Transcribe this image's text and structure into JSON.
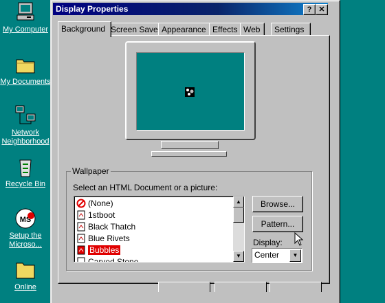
{
  "desktop": {
    "icons": [
      {
        "label": "My Computer"
      },
      {
        "label": "My Documents"
      },
      {
        "label": "Network Neighborhood"
      },
      {
        "label": "Recycle Bin"
      },
      {
        "label": "Setup the Microso..."
      },
      {
        "label": "Online"
      }
    ]
  },
  "window": {
    "title": "Display Properties",
    "help_button": "?",
    "close_button": "✕"
  },
  "tabs": [
    {
      "label": "Background",
      "active": true
    },
    {
      "label": "Screen Saver"
    },
    {
      "label": "Appearance"
    },
    {
      "label": "Effects"
    },
    {
      "label": "Web"
    },
    {
      "label": "Settings"
    }
  ],
  "wallpaper": {
    "group_label": "Wallpaper",
    "select_label": "Select an HTML Document or a picture:",
    "items": [
      {
        "label": "(None)",
        "icon": "none-icon"
      },
      {
        "label": "1stboot",
        "icon": "bitmap-file-icon"
      },
      {
        "label": "Black Thatch",
        "icon": "bitmap-file-icon"
      },
      {
        "label": "Blue Rivets",
        "icon": "bitmap-file-icon"
      },
      {
        "label": "Bubbles",
        "icon": "bitmap-file-icon",
        "selected": true
      },
      {
        "label": "Carved Stone",
        "icon": "bitmap-file-icon"
      }
    ],
    "browse_label": "Browse...",
    "pattern_label": "Pattern...",
    "display_label": "Display:",
    "display_value": "Center"
  },
  "colors": {
    "desktop": "#008080",
    "titlebar": "#000080",
    "selection": "#e00000"
  }
}
